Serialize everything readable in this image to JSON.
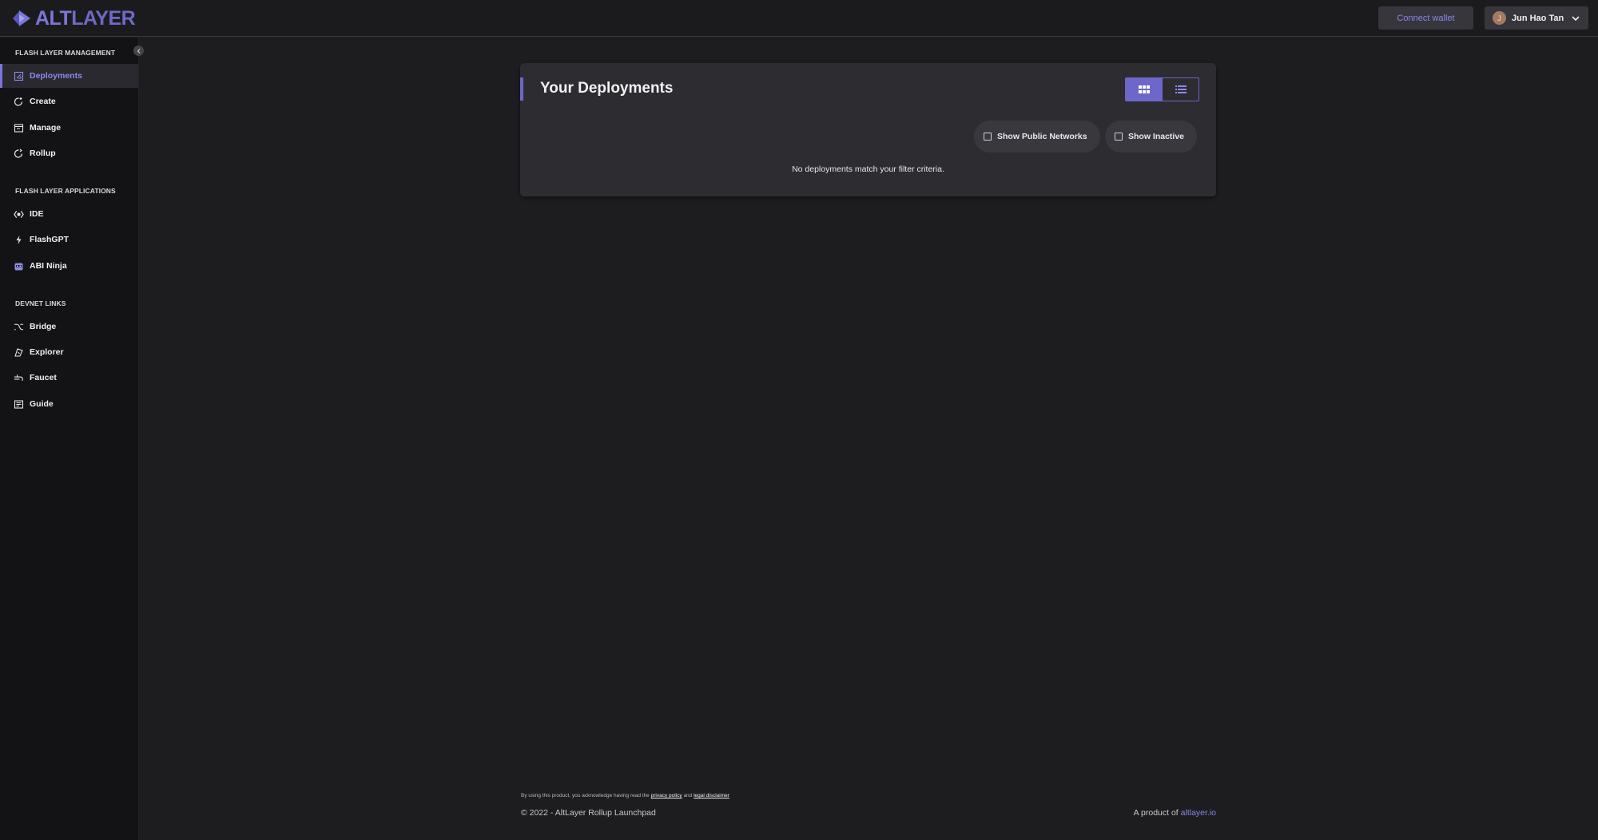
{
  "brand": {
    "logo_text_alt": "ALT",
    "logo_text_layer": "LAYER",
    "accent": "#6c67c8"
  },
  "header": {
    "connect_wallet_label": "Connect wallet",
    "user": {
      "initial": "J",
      "name": "Jun Hao Tan"
    }
  },
  "sidebar": {
    "sections": [
      {
        "title": "FLASH LAYER MANAGEMENT",
        "items": [
          {
            "label": "Deployments",
            "icon": "deployments-icon",
            "active": true
          },
          {
            "label": "Create",
            "icon": "create-icon"
          },
          {
            "label": "Manage",
            "icon": "manage-icon"
          },
          {
            "label": "Rollup",
            "icon": "rollup-icon"
          }
        ]
      },
      {
        "title": "FLASH LAYER APPLICATIONS",
        "items": [
          {
            "label": "IDE",
            "icon": "ide-icon"
          },
          {
            "label": "FlashGPT",
            "icon": "bolt-icon"
          },
          {
            "label": "ABI Ninja",
            "icon": "ninja-icon"
          }
        ]
      },
      {
        "title": "DEVNET LINKS",
        "items": [
          {
            "label": "Bridge",
            "icon": "bridge-icon"
          },
          {
            "label": "Explorer",
            "icon": "explorer-icon"
          },
          {
            "label": "Faucet",
            "icon": "faucet-icon"
          },
          {
            "label": "Guide",
            "icon": "guide-icon"
          }
        ]
      }
    ]
  },
  "main": {
    "title": "Your Deployments",
    "view_modes": [
      "grid",
      "list"
    ],
    "active_view": "grid",
    "filters": {
      "show_public_networks": {
        "label": "Show Public Networks",
        "checked": false
      },
      "show_inactive": {
        "label": "Show Inactive",
        "checked": false
      }
    },
    "empty_message": "No deployments match your filter criteria."
  },
  "footer": {
    "note_prefix": "By using this product, you acknowledge having read the",
    "privacy_link": "privacy policy",
    "and_text": "and",
    "disclaimer_link": "legal disclaimer",
    "copyright": "© 2022 - AltLayer Rollup Launchpad",
    "product_of_prefix": "A product of",
    "product_of_link": "altlayer.io"
  }
}
